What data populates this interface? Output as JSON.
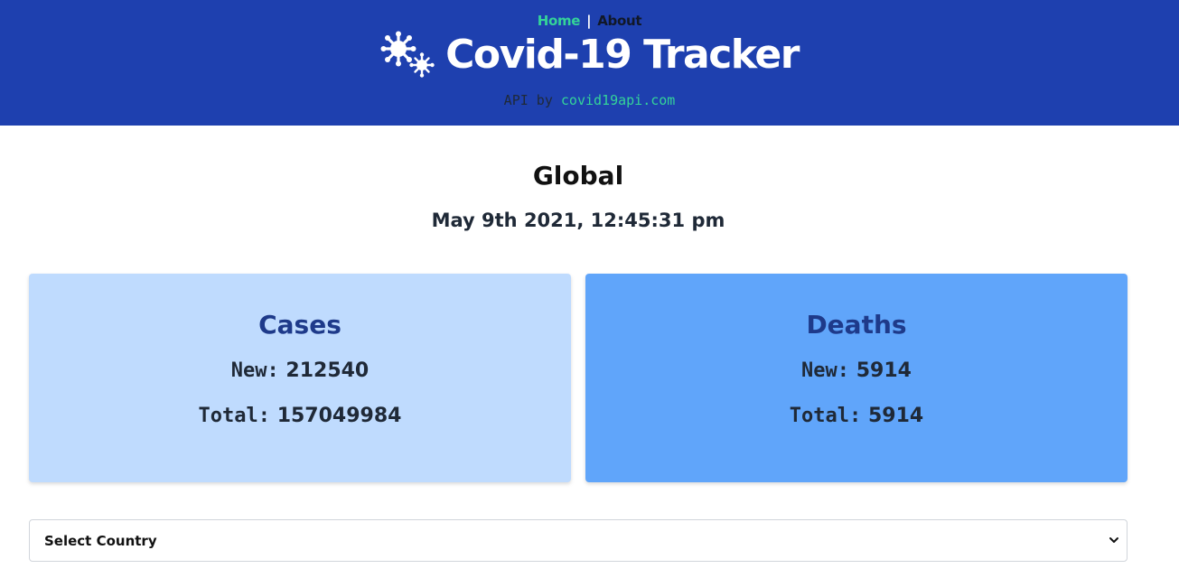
{
  "nav": {
    "home_label": "Home",
    "separator": "|",
    "about_label": "About"
  },
  "header": {
    "title": "Covid-19 Tracker",
    "api_prefix": "API by",
    "api_link": "covid19api.com",
    "logo_icon": "virus-icon"
  },
  "summary": {
    "region": "Global",
    "date": "May 9th 2021, 12:45:31 pm"
  },
  "cards": {
    "cases": {
      "title": "Cases",
      "new_label": "New:",
      "new_value": "212540",
      "total_label": "Total:",
      "total_value": "157049984"
    },
    "deaths": {
      "title": "Deaths",
      "new_label": "New:",
      "new_value": "5914",
      "total_label": "Total:",
      "total_value": "5914"
    }
  },
  "country_select": {
    "selected": "Select Country",
    "icon": "chevron-down-icon"
  },
  "colors": {
    "header_bg": "#1e40af",
    "accent_green": "#34d399",
    "cases_card": "#bfdbfe",
    "deaths_card": "#60a5fa",
    "card_title": "#1e3a8a"
  }
}
